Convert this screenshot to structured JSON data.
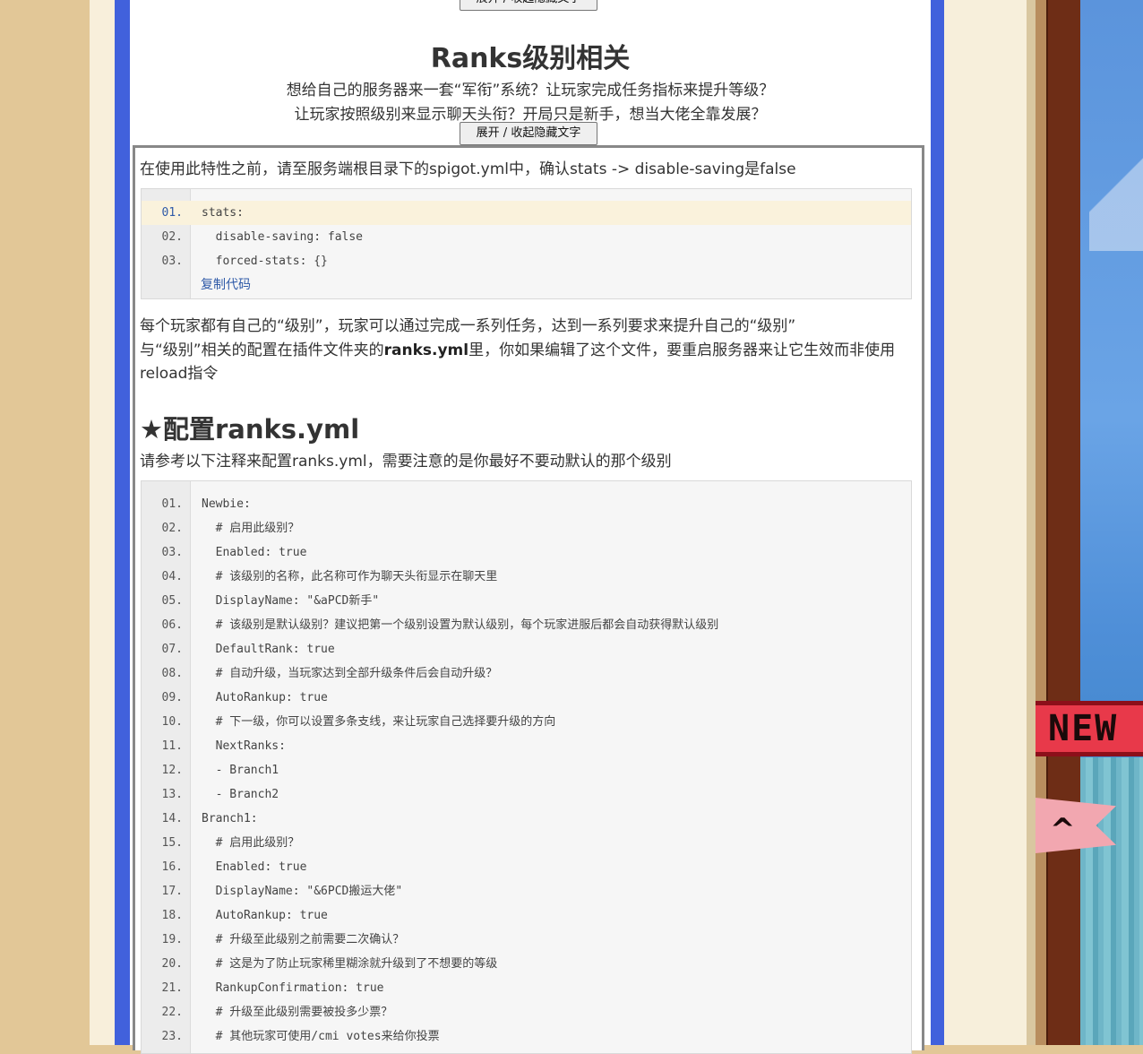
{
  "toggle_label": "展开 / 收起隐藏文字",
  "section": {
    "title": "Ranks级别相关",
    "subtitle_1": "想给自己的服务器来一套“军衔”系统？让玩家完成任务指标来提升等级？",
    "subtitle_2": "让玩家按照级别来显示聊天头衔？开局只是新手，想当大佬全靠发展？"
  },
  "intro": "在使用此特性之前，请至服务端根目录下的spigot.yml中，确认stats -> disable-saving是false",
  "code1": {
    "lines": [
      {
        "n": "01.",
        "t": "stats:"
      },
      {
        "n": "02.",
        "t": "  disable-saving: false"
      },
      {
        "n": "03.",
        "t": "  forced-stats: {}"
      }
    ],
    "copy_label": "复制代码"
  },
  "para": {
    "line1": "每个玩家都有自己的“级别”，玩家可以通过完成一系列任务，达到一系列要求来提升自己的“级别”",
    "line2_prefix": "与“级别”相关的配置在插件文件夹的",
    "line2_bold": "ranks.yml",
    "line2_suffix": "里，你如果编辑了这个文件，要重启服务器来让它生效而非使用",
    "line3": "reload指令"
  },
  "heading": "★配置ranks.yml",
  "heading_desc": "请参考以下注释来配置ranks.yml，需要注意的是你最好不要动默认的那个级别",
  "code2": {
    "lines": [
      {
        "n": "01.",
        "t": "Newbie:"
      },
      {
        "n": "02.",
        "t": "  # 启用此级别？"
      },
      {
        "n": "03.",
        "t": "  Enabled: true"
      },
      {
        "n": "04.",
        "t": "  # 该级别的名称，此名称可作为聊天头衔显示在聊天里"
      },
      {
        "n": "05.",
        "t": "  DisplayName: \"&aPCD新手\""
      },
      {
        "n": "06.",
        "t": "  # 该级别是默认级别？建议把第一个级别设置为默认级别，每个玩家进服后都会自动获得默认级别"
      },
      {
        "n": "07.",
        "t": "  DefaultRank: true"
      },
      {
        "n": "08.",
        "t": "  # 自动升级，当玩家达到全部升级条件后会自动升级？"
      },
      {
        "n": "09.",
        "t": "  AutoRankup: true"
      },
      {
        "n": "10.",
        "t": "  # 下一级，你可以设置多条支线，来让玩家自己选择要升级的方向"
      },
      {
        "n": "11.",
        "t": "  NextRanks:"
      },
      {
        "n": "12.",
        "t": "  - Branch1"
      },
      {
        "n": "13.",
        "t": "  - Branch2"
      },
      {
        "n": "14.",
        "t": "Branch1:"
      },
      {
        "n": "15.",
        "t": "  # 启用此级别？"
      },
      {
        "n": "16.",
        "t": "  Enabled: true"
      },
      {
        "n": "17.",
        "t": "  DisplayName: \"&6PCD搬运大佬\""
      },
      {
        "n": "18.",
        "t": "  AutoRankup: true"
      },
      {
        "n": "19.",
        "t": "  # 升级至此级别之前需要二次确认？"
      },
      {
        "n": "20.",
        "t": "  # 这是为了防止玩家稀里糊涂就升级到了不想要的等级"
      },
      {
        "n": "21.",
        "t": "  RankupConfirmation: true"
      },
      {
        "n": "22.",
        "t": "  # 升级至此级别需要被投多少票？"
      },
      {
        "n": "23.",
        "t": "  # 其他玩家可使用/cmi votes来给你投票"
      }
    ]
  },
  "side_badge": "NEW"
}
